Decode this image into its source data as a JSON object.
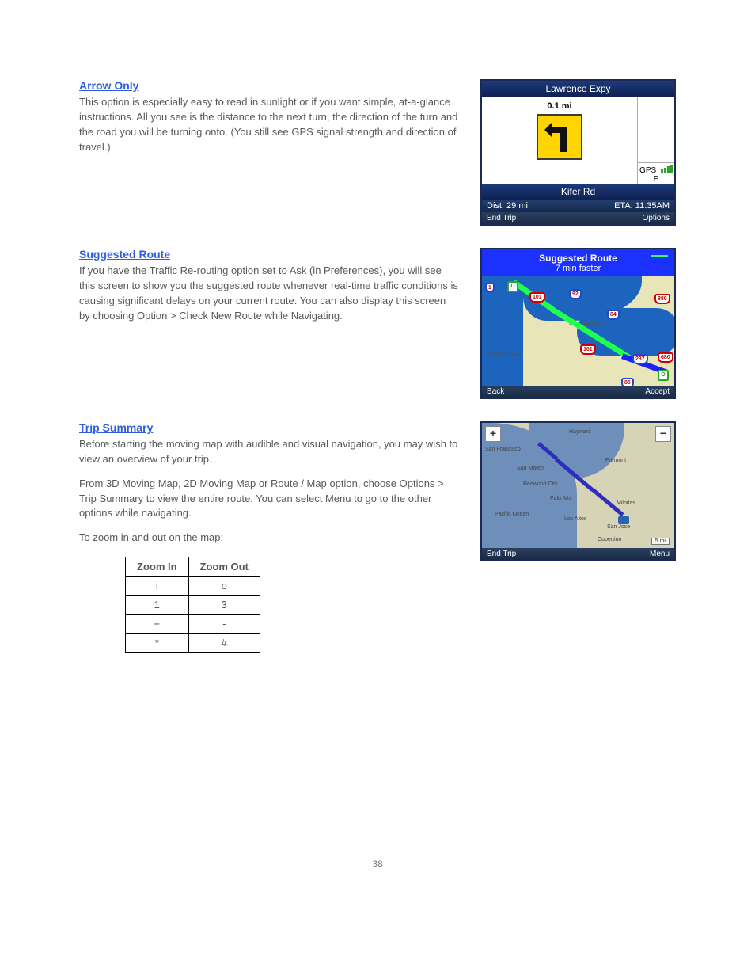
{
  "sections": {
    "arrow": {
      "heading": "Arrow Only",
      "p1": "This option is especially easy to read in sunlight or if you want simple, at-a-glance instructions.  All you see is the distance to the next turn, the direction of the turn and the road you will be turning onto.  (You still see GPS signal strength and direction of travel.)",
      "dev": {
        "title": "Lawrence Expy",
        "dist": "0.1 mi",
        "gps": "GPS",
        "dir": "E",
        "road": "Kifer Rd",
        "stat_l": "Dist: 29 mi",
        "stat_r": "ETA: 11:35AM",
        "sk_l": "End Trip",
        "sk_r": "Options"
      }
    },
    "suggested": {
      "heading": "Suggested Route",
      "p1": "If you have the Traffic Re-routing option set to Ask (in Preferences), you will see this screen to show you the suggested route whenever real-time traffic conditions is causing significant delays on your current route.  You can also display this screen by choosing Option > Check New Route while Navigating.",
      "dev": {
        "title_l1": "Suggested Route",
        "title_l2": "7 min faster",
        "sk_l": "Back",
        "sk_r": "Accept",
        "shields": [
          "1",
          "D",
          "101",
          "92",
          "84",
          "880",
          "101",
          "237",
          "680",
          "85",
          "O"
        ],
        "labels": {
          "sf": "San Francisco",
          "po": "Pacific Ocean"
        }
      }
    },
    "trip": {
      "heading": "Trip Summary",
      "p1": "Before starting the moving map with audible and visual navigation, you may wish to view an overview of your trip.",
      "p2": "From 3D Moving Map, 2D Moving Map or Route / Map option, choose Options > Trip Summary to view the entire route.  You can select Menu to go to the other options while navigating.",
      "p3": "To zoom in and out on the map:",
      "dev": {
        "sk_l": "End Trip",
        "sk_r": "Menu",
        "scale": "5 mi",
        "zoom_in": "+",
        "zoom_out": "−",
        "cities": [
          "San Francisco",
          "Hayward",
          "Fremont",
          "San Mateo",
          "Redwood City",
          "Palo Alto",
          "Los Altos",
          "Milpitas",
          "San Jose",
          "Cupertino",
          "Pacific Ocean"
        ]
      },
      "table": {
        "head": [
          "Zoom In",
          "Zoom Out"
        ],
        "rows": [
          [
            "i",
            "o"
          ],
          [
            "1",
            "3"
          ],
          [
            "+",
            "-"
          ],
          [
            "*",
            "#"
          ]
        ]
      }
    }
  },
  "pagenum": "38"
}
